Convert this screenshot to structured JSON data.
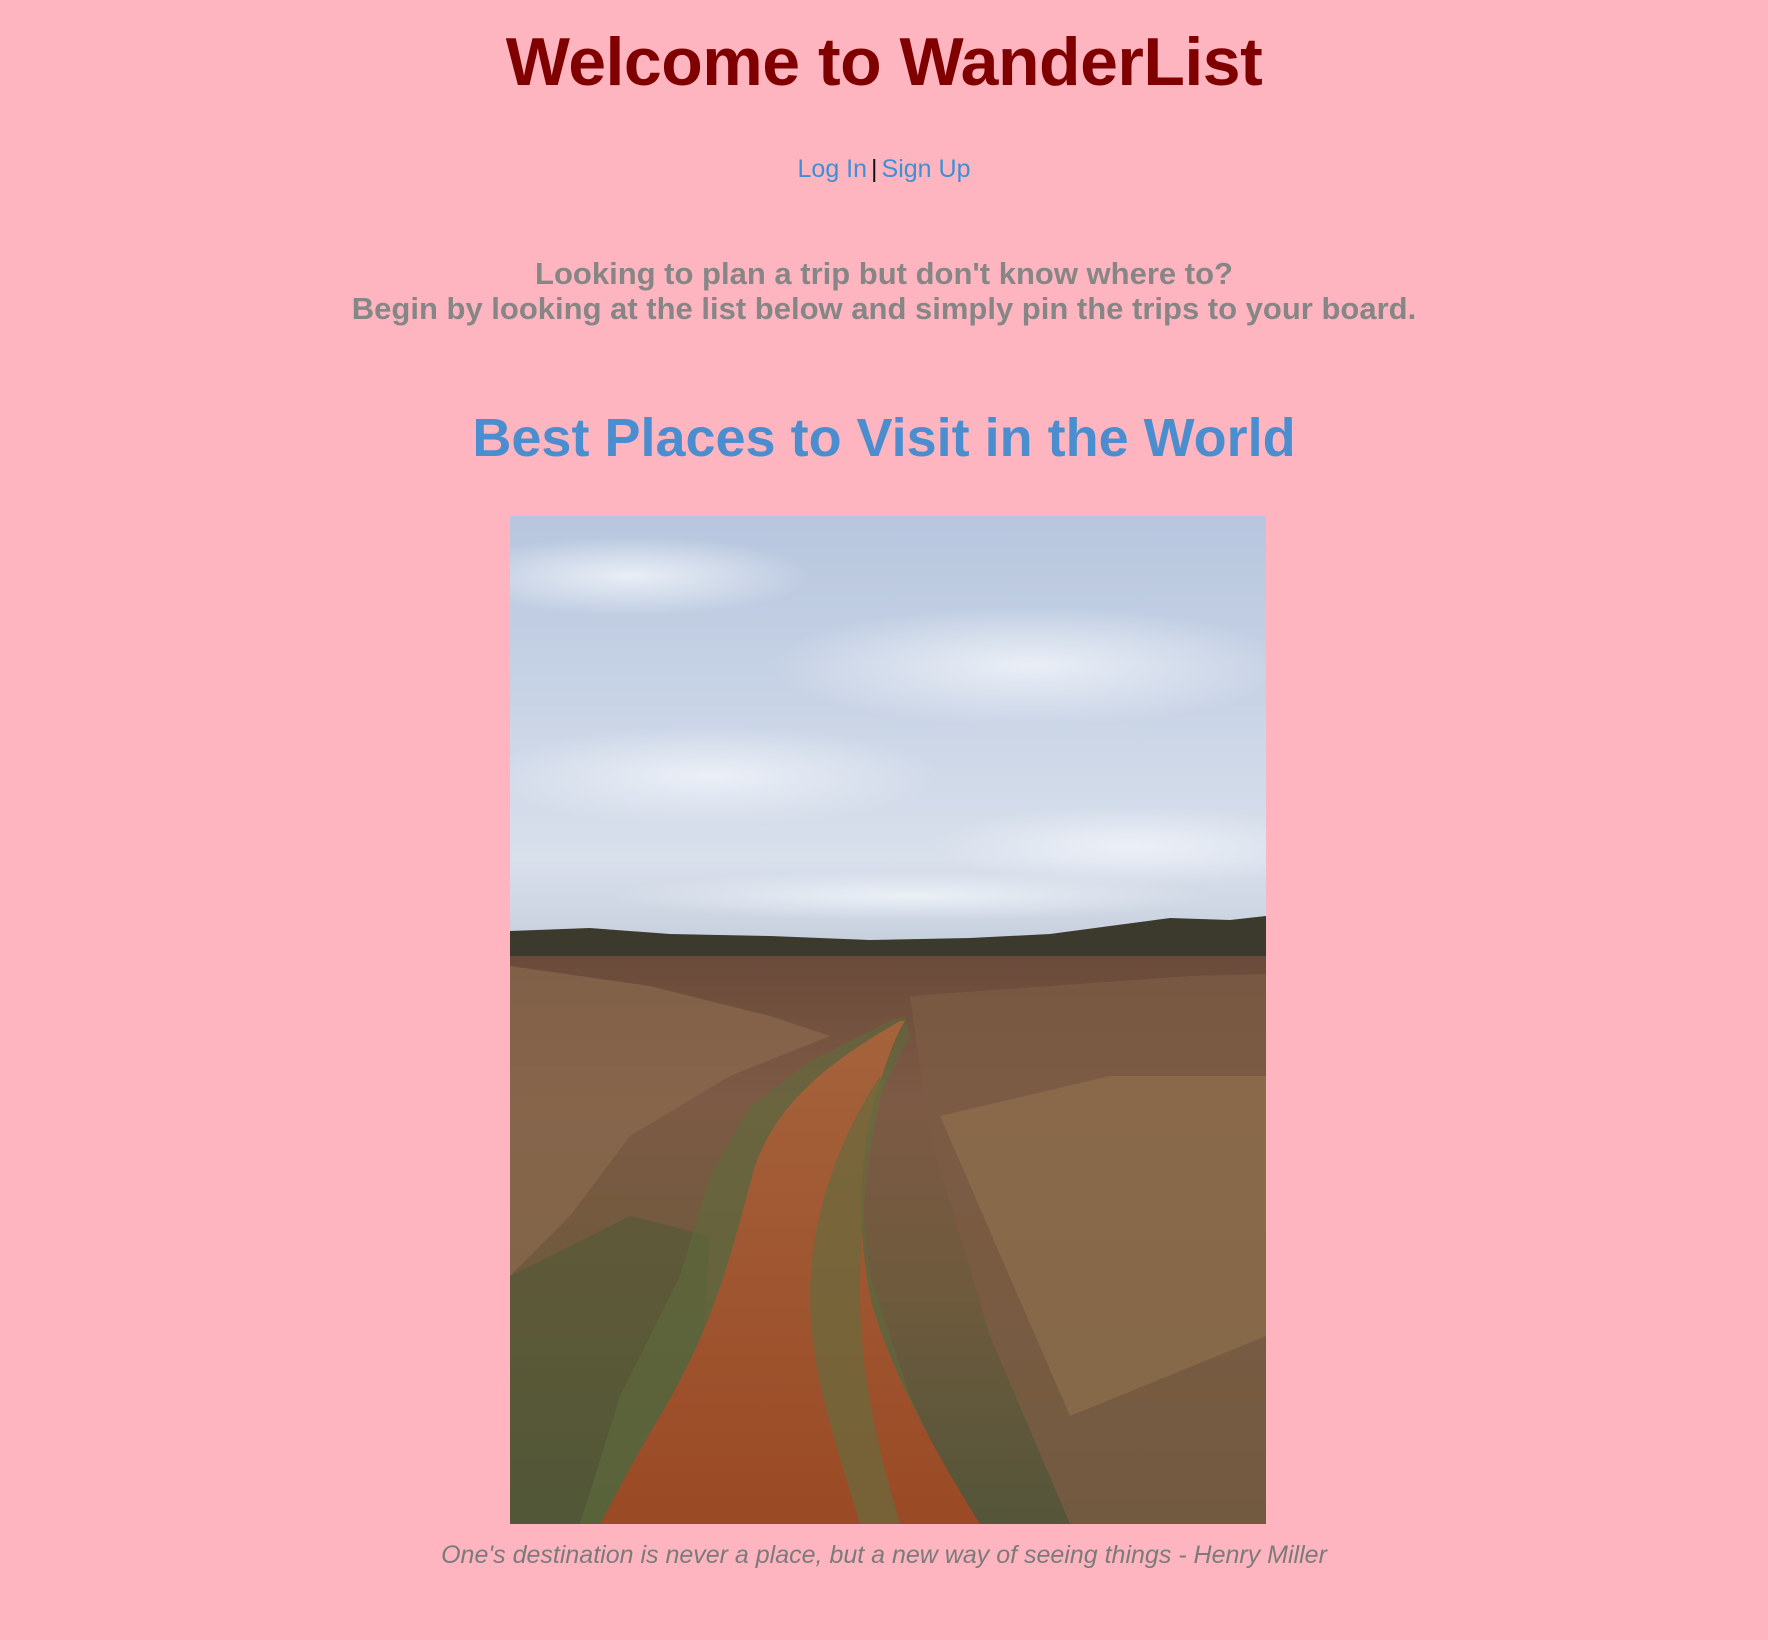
{
  "header": {
    "title": "Welcome to WanderList"
  },
  "auth": {
    "login_label": "Log In",
    "separator": "|",
    "signup_label": "Sign Up"
  },
  "intro": {
    "line1": "Looking to plan a trip but don't know where to?",
    "line2": "Begin by looking at the list below and simply pin the trips to your board."
  },
  "section": {
    "title": "Best Places to Visit in the World"
  },
  "featured": {
    "caption": "One's destination is never a place, but a new way of seeing things - Henry Miller"
  },
  "colors": {
    "background": "#ffb5c0",
    "title": "#800000",
    "link": "#3d8fd6",
    "intro_text": "#868686",
    "section_title": "#4a8ecf",
    "caption": "#7b7b7b"
  }
}
